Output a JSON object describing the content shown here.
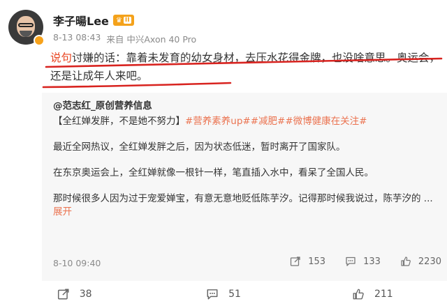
{
  "author": {
    "name": "李子暘Lee",
    "vip_level": "II",
    "time": "8-13 08:43",
    "source_prefix": "来自",
    "device": "中兴Axon 40 Pro"
  },
  "post": {
    "highlight": "说句",
    "text": "讨嫌的话：靠着未发育的幼女身材，去压水花得金牌，也没啥意思。奥运会，还是让成年人来吧。"
  },
  "repost": {
    "author": "@范志红_原创营养信息",
    "line1_text": "【全红婵发胖，不是她不努力】",
    "tags": [
      "#营养素养up#",
      "#减肥#",
      "#微博健康在关注#"
    ],
    "para2": "最近全网热议，全红婵发胖之后，因为状态低迷，暂时离开了国家队。",
    "para3": "在东京奥运会上，全红婵就像一根针一样，笔直插入水中，看呆了全国人民。",
    "para4": "那时候很多人因为过于宠爱婵宝，有意无意地贬低陈芋汐。记得那时候我说过，陈芋汐的",
    "ellipsis": " ... ",
    "expand_label": "展开",
    "time": "8-10 09:40",
    "shares": "153",
    "comments": "133",
    "likes": "2230"
  },
  "actions": {
    "shares": "38",
    "comments": "51",
    "likes": "211"
  },
  "colors": {
    "accent": "#eb7350",
    "highlight": "#e8431f",
    "vip": "#f4a21b",
    "underline": "#d8231f"
  }
}
